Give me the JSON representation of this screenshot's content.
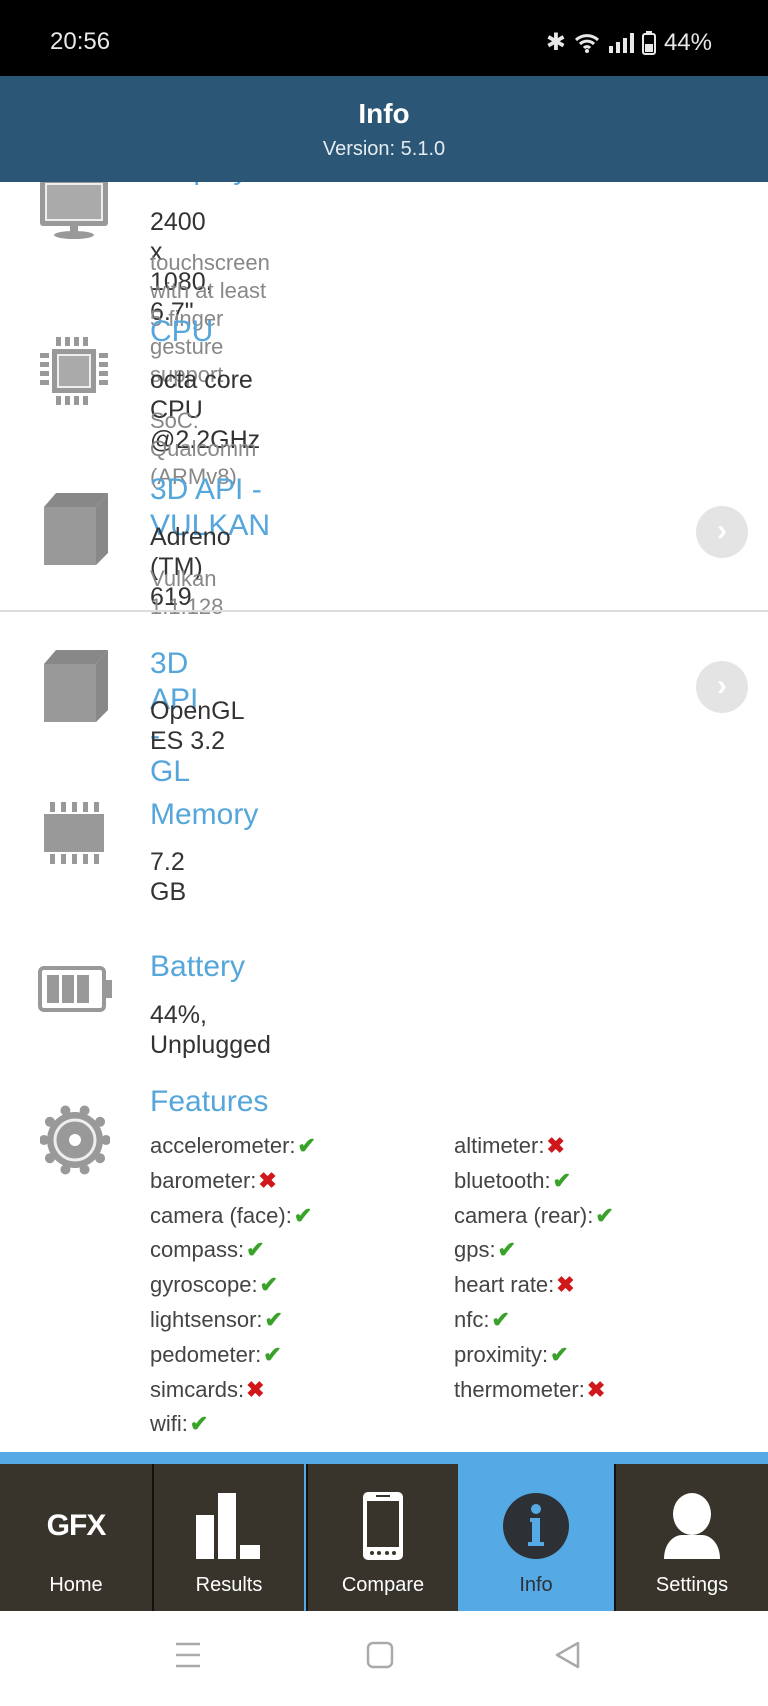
{
  "status_bar": {
    "time": "20:56",
    "battery": "44%",
    "icons": [
      "bluetooth-icon",
      "wifi-icon",
      "signal-icon",
      "battery-icon"
    ]
  },
  "header": {
    "title": "Info",
    "version": "Version: 5.1.0"
  },
  "items": [
    {
      "title": "Display",
      "main": "2400 x 1080, 6.7\"",
      "sub": "touchscreen with at least 5 finger gesture support",
      "icon": "monitor-icon"
    },
    {
      "title": "CPU",
      "main": "octa core CPU @2.2GHz",
      "sub": "SoC: Qualcomm (ARMv8)",
      "icon": "chip-icon"
    },
    {
      "title": "3D API - VULKAN",
      "main": "Adreno (TM) 619",
      "sub": "Vulkan 1.1.128",
      "icon": "cube-icon"
    },
    {
      "title": "3D API - GL",
      "main": "OpenGL ES 3.2",
      "icon": "cube-icon"
    },
    {
      "title": "Memory",
      "main": "7.2 GB",
      "icon": "memory-icon"
    },
    {
      "title": "Battery",
      "main": "44%, Unplugged",
      "icon": "battery-icon"
    }
  ],
  "features": {
    "title": "Features",
    "list": [
      {
        "name": "accelerometer:",
        "ok": true
      },
      {
        "name": "altimeter:",
        "ok": false
      },
      {
        "name": "barometer:",
        "ok": false
      },
      {
        "name": "bluetooth:",
        "ok": true
      },
      {
        "name": "camera (face):",
        "ok": true
      },
      {
        "name": "camera (rear):",
        "ok": true
      },
      {
        "name": "compass:",
        "ok": true
      },
      {
        "name": "gps:",
        "ok": true
      },
      {
        "name": "gyroscope:",
        "ok": true
      },
      {
        "name": "heart rate:",
        "ok": false
      },
      {
        "name": "lightsensor:",
        "ok": true
      },
      {
        "name": "nfc:",
        "ok": true
      },
      {
        "name": "pedometer:",
        "ok": true
      },
      {
        "name": "proximity:",
        "ok": true
      },
      {
        "name": "simcards:",
        "ok": false
      },
      {
        "name": "thermometer:",
        "ok": false
      },
      {
        "name": "wifi:",
        "ok": true
      }
    ],
    "check": "✔",
    "cross": "✖"
  },
  "tabs": [
    {
      "label": "Home",
      "logo": "GFX"
    },
    {
      "label": "Results"
    },
    {
      "label": "Compare"
    },
    {
      "label": "Info",
      "active": true
    },
    {
      "label": "Settings"
    }
  ],
  "colors": {
    "header": "#2c5675",
    "accent": "#55a6db",
    "tab_bg": "#38342c",
    "tab_active": "#55a9e5",
    "ok": "#3aa22a",
    "no": "#d0181b"
  }
}
